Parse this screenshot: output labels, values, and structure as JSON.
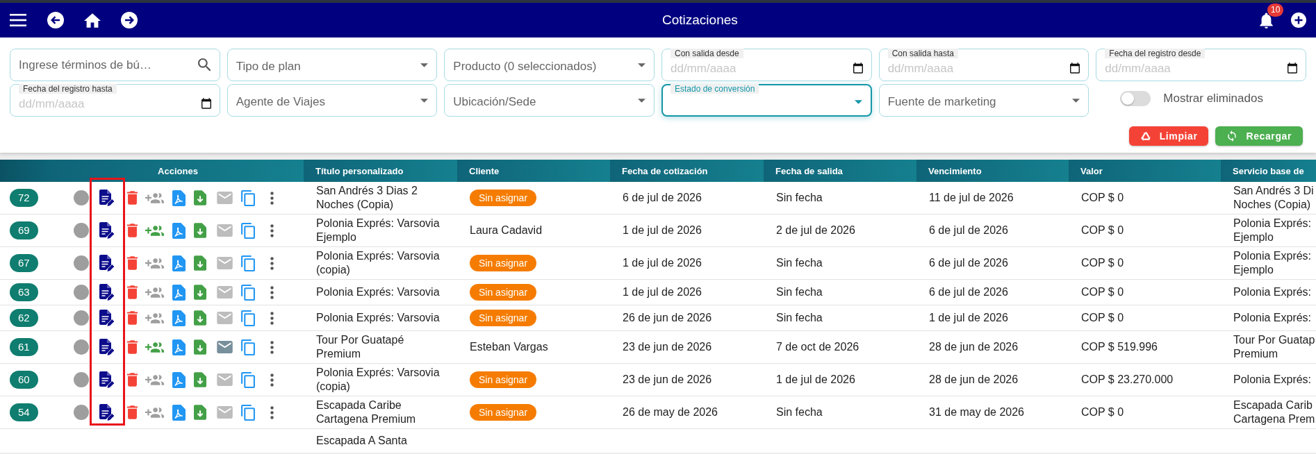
{
  "header": {
    "title": "Cotizaciones",
    "notification_count": "10"
  },
  "filters": [
    {
      "kind": "search",
      "placeholder": "Ingrese términos de bú…"
    },
    {
      "kind": "select",
      "label": "Tipo de plan",
      "focused": false
    },
    {
      "kind": "select",
      "label": "Producto (0 seleccionados)",
      "focused": false
    },
    {
      "kind": "date",
      "label": "Con salida desde",
      "placeholder": "dd/mm/aaaa"
    },
    {
      "kind": "date",
      "label": "Con salida hasta",
      "placeholder": "dd/mm/aaaa"
    },
    {
      "kind": "date",
      "label": "Fecha del registro desde",
      "placeholder": "dd/mm/aaaa"
    },
    {
      "kind": "date",
      "label": "Fecha del registro hasta",
      "placeholder": "dd/mm/aaaa"
    },
    {
      "kind": "select",
      "label": "Agente de Viajes",
      "focused": false
    },
    {
      "kind": "select",
      "label": "Ubicación/Sede",
      "focused": false
    },
    {
      "kind": "select",
      "label": "Estado de conversión",
      "focused": true
    },
    {
      "kind": "select",
      "label": "Fuente de marketing",
      "focused": false
    },
    {
      "kind": "toggle",
      "label": "Mostrar eliminados",
      "on": false
    }
  ],
  "buttons": [
    {
      "kind": "clear",
      "label": "Limpiar"
    },
    {
      "kind": "reload",
      "label": "Recargar"
    }
  ],
  "table": {
    "highlight_frame": true,
    "columns": [
      "Acciones",
      "Título personalizado",
      "Cliente",
      "Fecha de cotización",
      "Fecha de salida",
      "Vencimiento",
      "Valor",
      "Servicio base de"
    ],
    "rows": [
      {
        "id": "72",
        "actions": {
          "add_person_active": false,
          "mail_active": false
        },
        "title": "San Andrés 3 Dias 2 Noches (Copia)",
        "client": {
          "kind": "badge",
          "label": "Sin asignar"
        },
        "quote_date": "6 de jul de 2026",
        "departure_date": "Sin fecha",
        "expiry": "11 de jul de 2026",
        "value": "COP $ 0",
        "base_service": [
          "San Andrés 3 Di",
          "Noches (Copia)"
        ]
      },
      {
        "id": "69",
        "actions": {
          "add_person_active": true,
          "mail_active": false
        },
        "title": "Polonia Exprés: Varsovia Ejemplo",
        "client": {
          "kind": "text",
          "label": "Laura Cadavid"
        },
        "quote_date": "1 de jul de 2026",
        "departure_date": "2 de jul de 2026",
        "expiry": "6 de jul de 2026",
        "value": "COP $ 0",
        "base_service": [
          "Polonia Exprés:",
          "Ejemplo"
        ]
      },
      {
        "id": "67",
        "actions": {
          "add_person_active": false,
          "mail_active": false
        },
        "title": "Polonia Exprés: Varsovia (copia)",
        "client": {
          "kind": "badge",
          "label": "Sin asignar"
        },
        "quote_date": "1 de jul de 2026",
        "departure_date": "Sin fecha",
        "expiry": "6 de jul de 2026",
        "value": "COP $ 0",
        "base_service": [
          "Polonia Exprés:",
          "Ejemplo"
        ]
      },
      {
        "id": "63",
        "actions": {
          "add_person_active": false,
          "mail_active": false
        },
        "title": "Polonia Exprés: Varsovia",
        "client": {
          "kind": "badge",
          "label": "Sin asignar"
        },
        "quote_date": "1 de jul de 2026",
        "departure_date": "Sin fecha",
        "expiry": "6 de jul de 2026",
        "value": "COP $ 0",
        "base_service": [
          "Polonia Exprés:"
        ]
      },
      {
        "id": "62",
        "actions": {
          "add_person_active": false,
          "mail_active": false
        },
        "title": "Polonia Exprés: Varsovia",
        "client": {
          "kind": "badge",
          "label": "Sin asignar"
        },
        "quote_date": "26 de jun de 2026",
        "departure_date": "Sin fecha",
        "expiry": "1 de jul de 2026",
        "value": "COP $ 0",
        "base_service": [
          "Polonia Exprés:"
        ]
      },
      {
        "id": "61",
        "actions": {
          "add_person_active": true,
          "mail_active": true
        },
        "title": "Tour Por Guatapé Premium",
        "client": {
          "kind": "text",
          "label": "Esteban Vargas"
        },
        "quote_date": "23 de jun de 2026",
        "departure_date": "7 de oct de 2026",
        "expiry": "28 de jun de 2026",
        "value": "COP $ 519.996",
        "base_service": [
          "Tour Por Guatap",
          "Premium"
        ]
      },
      {
        "id": "60",
        "actions": {
          "add_person_active": false,
          "mail_active": false
        },
        "title": "Polonia Exprés: Varsovia (copia)",
        "client": {
          "kind": "badge",
          "label": "Sin asignar"
        },
        "quote_date": "23 de jun de 2026",
        "departure_date": "1 de jul de 2026",
        "expiry": "28 de jun de 2026",
        "value": "COP $ 23.270.000",
        "base_service": [
          "Polonia Exprés:"
        ]
      },
      {
        "id": "54",
        "actions": {
          "add_person_active": false,
          "mail_active": false
        },
        "title": "Escapada Caribe Cartagena Premium",
        "client": {
          "kind": "badge",
          "label": "Sin asignar"
        },
        "quote_date": "26 de may de 2026",
        "departure_date": "Sin fecha",
        "expiry": "31 de may de 2026",
        "value": "COP $ 0",
        "base_service": [
          "Escapada Carib",
          "Cartagena Prem"
        ]
      },
      {
        "title": "Escapada A Santa"
      }
    ]
  }
}
